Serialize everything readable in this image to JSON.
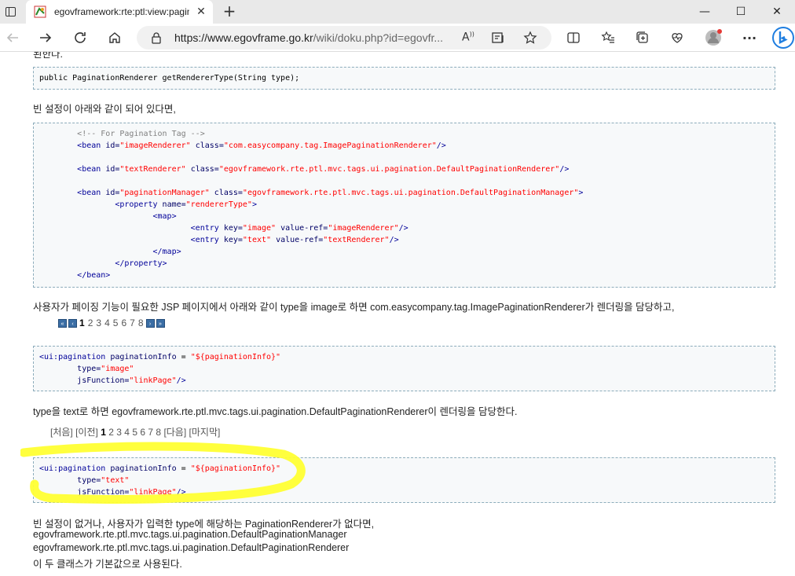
{
  "browser": {
    "tab_title": "egovframework:rte:ptl:view:pagin",
    "tab_close": "✕",
    "new_tab": "+",
    "address_host": "https://www.egovframe.go.kr",
    "address_path": "/wiki/doku.php?id=egovfr...",
    "read_aloud": "A",
    "minimize": "—",
    "maximize": "☐",
    "close": "✕",
    "more": "···"
  },
  "page": {
    "cut_top_text": "된한다.",
    "code1": "public PaginationRenderer getRendererType(String type);",
    "p_bean": "빈 설정이 아래와 같이 되어 있다면,",
    "code2": {
      "l1_comment": "<!-- For Pagination Tag -->",
      "l2_tag": "<bean",
      "l2_a1": "id=",
      "l2_v1": "\"imageRenderer\"",
      "l2_a2": "class=",
      "l2_v2": "\"com.easycompany.tag.ImagePaginationRenderer\"",
      "l2_end": "/>",
      "l3_tag": "<bean",
      "l3_a1": "id=",
      "l3_v1": "\"textRenderer\"",
      "l3_a2": "class=",
      "l3_v2": "\"egovframework.rte.ptl.mvc.tags.ui.pagination.DefaultPaginationRenderer\"",
      "l3_end": "/>",
      "l4_tag": "<bean",
      "l4_a1": "id=",
      "l4_v1": "\"paginationManager\"",
      "l4_a2": "class=",
      "l4_v2": "\"egovframework.rte.ptl.mvc.tags.ui.pagination.DefaultPaginationManager\"",
      "l4_end": ">",
      "l5_tag": "<property",
      "l5_a1": "name=",
      "l5_v1": "\"rendererType\"",
      "l5_end": ">",
      "l6": "<map>",
      "l7_tag": "<entry",
      "l7_a1": "key=",
      "l7_v1": "\"image\"",
      "l7_a2": "value-ref=",
      "l7_v2": "\"imageRenderer\"",
      "l7_end": "/>",
      "l8_tag": "<entry",
      "l8_a1": "key=",
      "l8_v1": "\"text\"",
      "l8_a2": "value-ref=",
      "l8_v2": "\"textRenderer\"",
      "l8_end": "/>",
      "l9": "</map>",
      "l10": "</property>",
      "l11": "</bean>"
    },
    "p_image": "사용자가 페이징 기능이 필요한 JSP 페이지에서 아래와 같이 type을 image로 하면 com.easycompany.tag.ImagePaginationRenderer가 렌더링을 담당하고,",
    "pager_image": {
      "first": "«",
      "prev": "‹",
      "current": "1",
      "pages": [
        "2",
        "3",
        "4",
        "5",
        "6",
        "7",
        "8"
      ],
      "next": "›",
      "last": "»"
    },
    "code3": {
      "l1_tag": "<ui:pagination",
      "l1_a": "paginationInfo",
      "l1_eq": " = ",
      "l1_v": "\"${paginationInfo}\"",
      "l2_a": "type=",
      "l2_v": "\"image\"",
      "l3_a": "jsFunction=",
      "l3_v": "\"linkPage\"",
      "l3_end": "/>"
    },
    "p_text": "type을 text로 하면 egovframework.rte.ptl.mvc.tags.ui.pagination.DefaultPaginationRenderer이 렌더링을 담당한다.",
    "pager_text": {
      "first": "[처음]",
      "prev": "[이전]",
      "current": "1",
      "pages": [
        "2",
        "3",
        "4",
        "5",
        "6",
        "7",
        "8"
      ],
      "next": "[다음]",
      "last": "[마지막]"
    },
    "code4": {
      "l1_tag": "<ui:pagination",
      "l1_a": "paginationInfo",
      "l1_eq": " = ",
      "l1_v": "\"${paginationInfo}\"",
      "l2_a": "type=",
      "l2_v": "\"text\"",
      "l3_a": "jsFunction=",
      "l3_v": "\"linkPage\"",
      "l3_end": "/>"
    },
    "p_final1": "빈 설정이 없거나, 사용자가 입력한 type에 해당하는 PaginationRenderer가 없다면,",
    "p_final2": "egovframework.rte.ptl.mvc.tags.ui.pagination.DefaultPaginationManager",
    "p_final3": "egovframework.rte.ptl.mvc.tags.ui.pagination.DefaultPaginationRenderer",
    "p_final4": "이 두 클래스가 기본값으로 사용된다."
  },
  "colors": {
    "highlight": "#ffff33",
    "tag": "#000099",
    "string": "#ff0000",
    "comment": "#808080"
  }
}
